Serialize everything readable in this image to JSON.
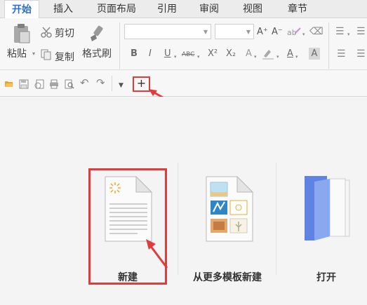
{
  "ribbon_tabs": [
    "开始",
    "插入",
    "页面布局",
    "引用",
    "审阅",
    "视图",
    "章节"
  ],
  "clipboard": {
    "paste_label": "粘贴",
    "cut_label": "剪切",
    "copy_label": "复制",
    "format_painter_label": "格式刷"
  },
  "format_buttons": [
    "B",
    "I",
    "U",
    "ABC",
    "X²",
    "X₂",
    "A",
    "A",
    "A"
  ],
  "font_size_buttons": [
    "A⁺",
    "A⁻"
  ],
  "start_page": {
    "new_label": "新建",
    "template_label": "从更多模板新建",
    "open_label": "打开"
  },
  "colors": {
    "accent": "#2a6fcf",
    "highlight_box": "#e23b3b",
    "folder": "#6b8fe6"
  }
}
